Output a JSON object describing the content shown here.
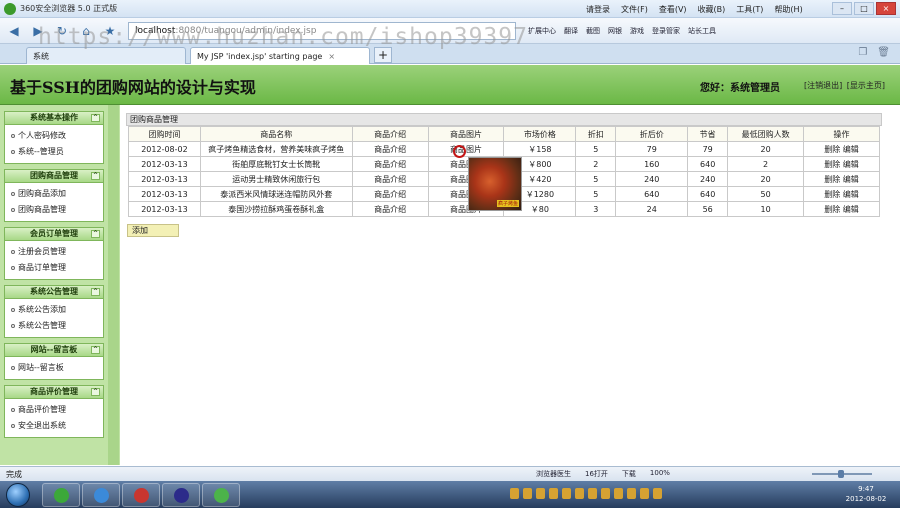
{
  "browser": {
    "app_title": "360安全浏览器 5.0 正式版",
    "menu": [
      "文件(F)",
      "查看(V)",
      "收藏(B)",
      "工具(T)",
      "帮助(H)"
    ],
    "login_label": "请登录",
    "address_host": "localhost",
    "address_rest": ":8080/tuangou/admin/index.jsp",
    "toolbar": [
      "扩展中心",
      "翻译",
      "截图",
      "网银",
      "游戏",
      "登录管家",
      "站长工具"
    ],
    "tabs": [
      {
        "label": "系统"
      },
      {
        "label": "My JSP 'index.jsp' starting page"
      }
    ],
    "watermark": "https://www.huzhan.com/ishop39397"
  },
  "site": {
    "title": "基于SSH的团购网站的设计与实现",
    "greeting": "您好：系统管理员",
    "links": [
      "[注销退出]",
      "[显示主页]"
    ]
  },
  "sidebar": {
    "groups": [
      {
        "title": "系统基本操作",
        "items": [
          "个人密码修改",
          "系统--管理员"
        ]
      },
      {
        "title": "团购商品管理",
        "items": [
          "团购商品添加",
          "团购商品管理"
        ]
      },
      {
        "title": "会员订单管理",
        "items": [
          "注册会员管理",
          "商品订单管理"
        ]
      },
      {
        "title": "系统公告管理",
        "items": [
          "系统公告添加",
          "系统公告管理"
        ]
      },
      {
        "title": "网站--留言板",
        "items": [
          "网站--留言板"
        ]
      },
      {
        "title": "商品评价管理",
        "items": [
          "商品评价管理",
          "安全退出系统"
        ]
      }
    ]
  },
  "main": {
    "panel_title": "团购商品管理",
    "columns": [
      "团购时间",
      "商品名称",
      "商品介绍",
      "商品图片",
      "市场价格",
      "折扣",
      "折后价",
      "节省",
      "最低团购人数",
      "操作"
    ],
    "rows": [
      [
        "2012-08-02",
        "疯子烤鱼精选食材，营养美味疯子烤鱼",
        "商品介绍",
        "商品图片",
        "￥158",
        "5",
        "79",
        "79",
        "20",
        "删除 编辑"
      ],
      [
        "2012-03-13",
        "街舶厚底靴钉女士长筒靴",
        "商品介绍",
        "商品图片",
        "￥800",
        "2",
        "160",
        "640",
        "2",
        "删除 编辑"
      ],
      [
        "2012-03-13",
        "运动男士精致休闲旅行包",
        "商品介绍",
        "商品图片",
        "￥420",
        "5",
        "240",
        "240",
        "20",
        "删除 编辑"
      ],
      [
        "2012-03-13",
        "泰派西米风情球迷连帽防风外套",
        "商品介绍",
        "商品图片",
        "￥1280",
        "5",
        "640",
        "640",
        "50",
        "删除 编辑"
      ],
      [
        "2012-03-13",
        "泰国沙捞拉酥鸡蛋卷酥礼盒",
        "商品介绍",
        "商品图片",
        "￥80",
        "3",
        "24",
        "56",
        "10",
        "删除 编辑"
      ]
    ],
    "add_label": "添加",
    "popup_tag": "疯子烤鱼"
  },
  "status": {
    "left": "完成",
    "right": [
      "浏览器医生",
      "16打开",
      "下载",
      "100%"
    ]
  },
  "taskbar": {
    "time": "9:47",
    "date": "2012-08-02"
  }
}
